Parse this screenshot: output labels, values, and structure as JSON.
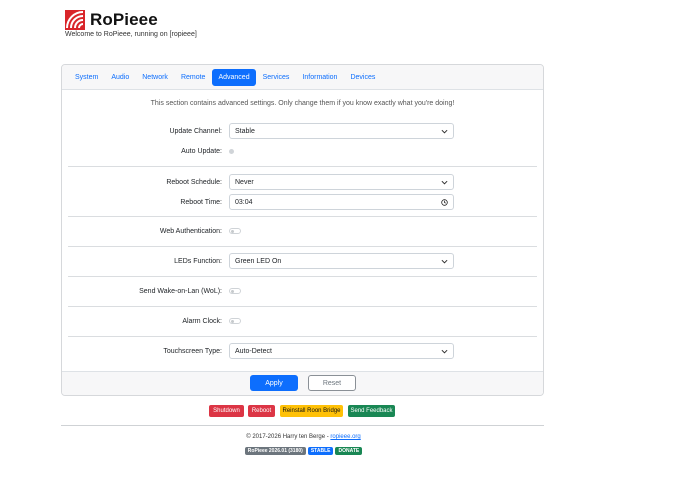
{
  "header": {
    "title": "RoPieee",
    "welcome": "Welcome to RoPieee, running on [ropieee]"
  },
  "tabs": [
    {
      "label": "System"
    },
    {
      "label": "Audio"
    },
    {
      "label": "Network"
    },
    {
      "label": "Remote"
    },
    {
      "label": "Advanced"
    },
    {
      "label": "Services"
    },
    {
      "label": "Information"
    },
    {
      "label": "Devices"
    }
  ],
  "intro": "This section contains advanced settings. Only change them if you know exactly what you're doing!",
  "settings": {
    "update_channel": {
      "label": "Update Channel:",
      "value": "Stable"
    },
    "auto_update": {
      "label": "Auto Update:"
    },
    "reboot_schedule": {
      "label": "Reboot Schedule:",
      "value": "Never"
    },
    "reboot_time": {
      "label": "Reboot Time:",
      "value": "03:04"
    },
    "web_auth": {
      "label": "Web Authentication:"
    },
    "leds_function": {
      "label": "LEDs Function:",
      "value": "Green LED On"
    },
    "wol": {
      "label": "Send Wake-on-Lan (WoL):"
    },
    "alarm_clock": {
      "label": "Alarm Clock:"
    },
    "touchscreen": {
      "label": "Touchscreen Type:",
      "value": "Auto-Detect"
    }
  },
  "footer_buttons": {
    "apply": "Apply",
    "reset": "Reset"
  },
  "actions": {
    "shutdown": "Shutdown",
    "reboot": "Reboot",
    "reinstall": "Reinstall Roon Bridge",
    "feedback": "Send Feedback"
  },
  "copyright": {
    "text": "© 2017-2026 Harry ten Berge - ",
    "link": "ropieee.org"
  },
  "badges": {
    "version": "RoPieee 2026.01 (3180)",
    "channel": "STABLE",
    "donate": "DONATE"
  },
  "colors": {
    "primary": "#0d6efd",
    "danger": "#dc3545",
    "warning": "#ffc107",
    "success": "#198754",
    "secondary": "#6c757d",
    "logo": "#d9252a"
  }
}
